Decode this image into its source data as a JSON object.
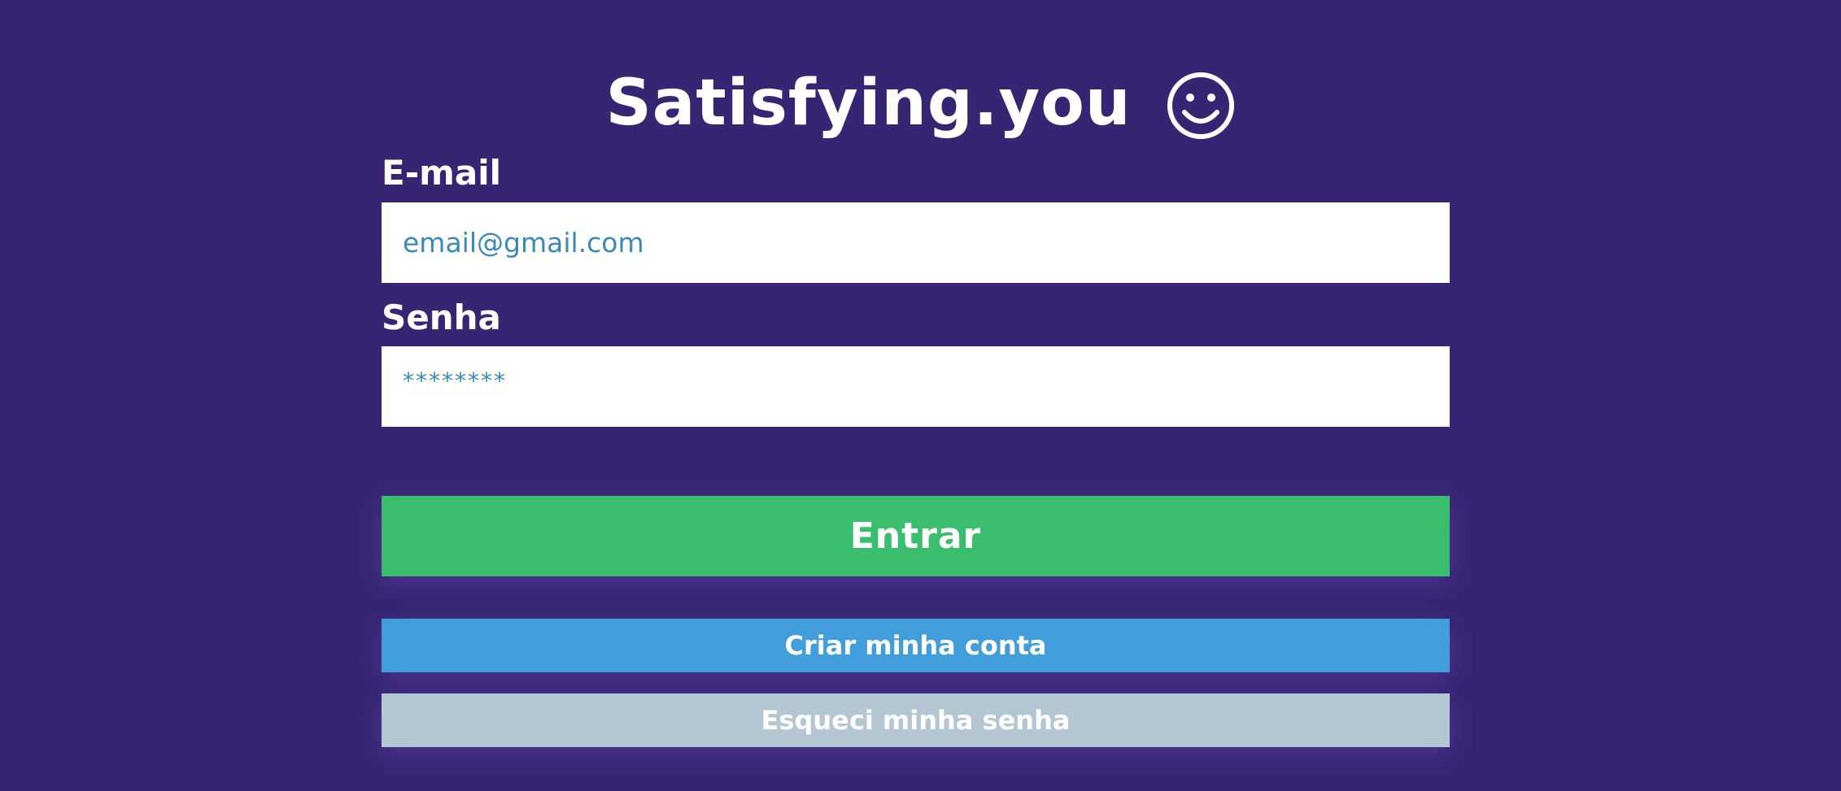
{
  "app": {
    "title": "Satisfying.you"
  },
  "form": {
    "email_label": "E-mail",
    "email_value": "email@gmail.com",
    "password_label": "Senha",
    "password_value": "********"
  },
  "actions": {
    "login_label": "Entrar",
    "create_account_label": "Criar minha conta",
    "forgot_password_label": "Esqueci minha senha"
  },
  "icons": {
    "title_icon": "smiley-face-icon"
  },
  "colors": {
    "background": "#372573",
    "login_button": "#3abe6e",
    "create_button": "#429edb",
    "forgot_button": "#b3c6d1",
    "input_text": "#3a8ab8"
  }
}
